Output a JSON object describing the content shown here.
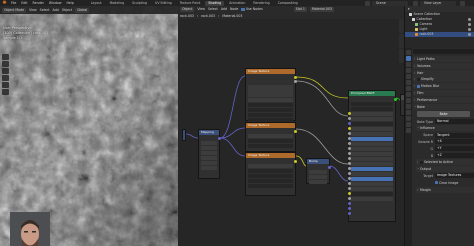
{
  "app": {
    "menus": [
      "File",
      "Edit",
      "Render",
      "Window",
      "Help"
    ],
    "workspaces": [
      "Layout",
      "Modeling",
      "Sculpting",
      "UV Editing",
      "Texture Paint",
      "Shading",
      "Animation",
      "Rendering",
      "Compositing"
    ],
    "active_workspace": "Shading",
    "scene": "Scene",
    "view_layer": "View Layer"
  },
  "viewport": {
    "mode": "Object Mode",
    "menus": [
      "View",
      "Select",
      "Add",
      "Object"
    ],
    "orientation": "Global",
    "info_lines": [
      "User Perspective",
      "(100) Collection | rock.003",
      "Sample 1/1"
    ]
  },
  "node_editor": {
    "editor_type": "Object",
    "menus": [
      "View",
      "Select",
      "Add",
      "Node"
    ],
    "use_nodes_label": "Use Nodes",
    "slot": "Slot 1",
    "material": "Material.003",
    "breadcrumb": [
      "rock.003",
      "rock.003",
      "Material.003"
    ],
    "nodes": {
      "texture1_title": "Image Texture",
      "texture2_title": "Image Texture",
      "texture3_title": "Image Texture",
      "mapping_title": "Mapping",
      "bump_title": "Bump",
      "bsdf_title": "Principled BSDF",
      "output_title": "Material Output"
    }
  },
  "outliner": {
    "title": "Scene Collection",
    "items": [
      {
        "label": "Collection",
        "selected": false
      },
      {
        "label": "Camera",
        "selected": false
      },
      {
        "label": "Light",
        "selected": false
      },
      {
        "label": "rock.003",
        "selected": true
      }
    ]
  },
  "properties": {
    "sections": [
      {
        "label": "Light Paths",
        "open": false
      },
      {
        "label": "Volumes",
        "open": false
      },
      {
        "label": "Hair",
        "open": false
      },
      {
        "label": "Simplify",
        "open": false,
        "checkbox": false
      },
      {
        "label": "Motion Blur",
        "open": false,
        "checkbox": true
      },
      {
        "label": "Film",
        "open": false
      },
      {
        "label": "Performance",
        "open": false
      },
      {
        "label": "Bake",
        "open": true
      }
    ],
    "bake_button": "Bake",
    "bake_type_label": "Bake Type",
    "bake_type_value": "Normal",
    "influence_label": "Influence",
    "space_label": "Space",
    "space_value": "Tangent",
    "swizzle_labels": [
      "Swizzle R",
      "G",
      "B"
    ],
    "swizzle_values": [
      "+X",
      "+Y",
      "+Z"
    ],
    "selected_to_active": "Selected to Active",
    "output_label": "Output",
    "target_label": "Target",
    "target_value": "Image Textures",
    "clear_image": "Clear Image",
    "margin_label": "Margin"
  }
}
